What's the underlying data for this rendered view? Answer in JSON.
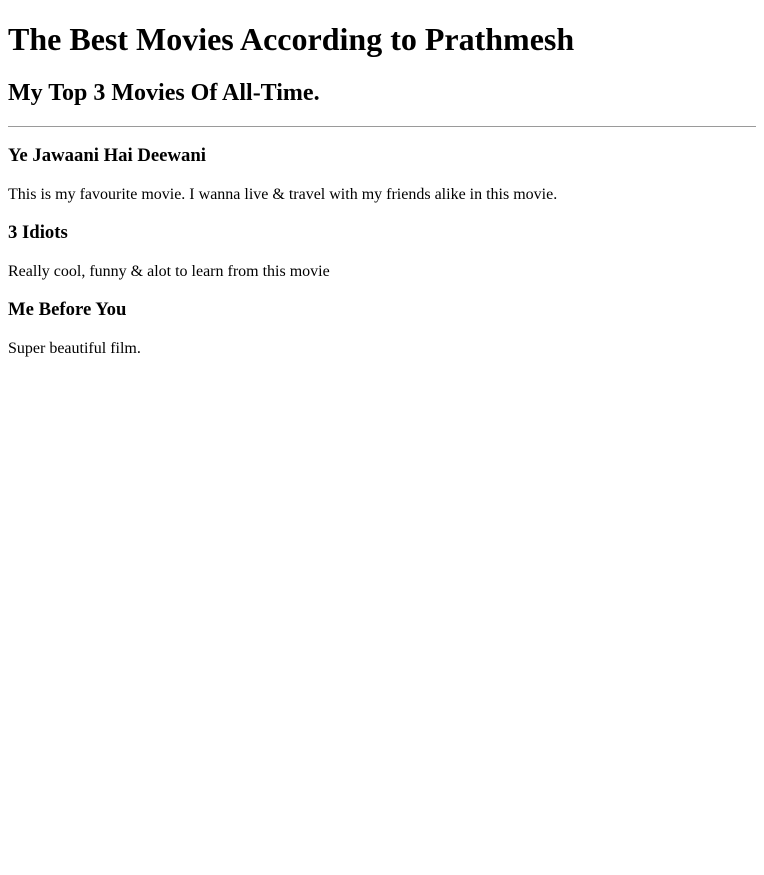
{
  "page": {
    "title": "The Best Movies According to Prathmesh",
    "subtitle": "My Top 3 Movies Of All-Time."
  },
  "movies": [
    {
      "title": "Ye Jawaani Hai Deewani",
      "description": "This is my favourite movie. I wanna live & travel with my friends alike in this movie."
    },
    {
      "title": "3 Idiots",
      "description": "Really cool, funny & alot to learn from this movie"
    },
    {
      "title": "Me Before You",
      "description": "Super beautiful film."
    }
  ]
}
